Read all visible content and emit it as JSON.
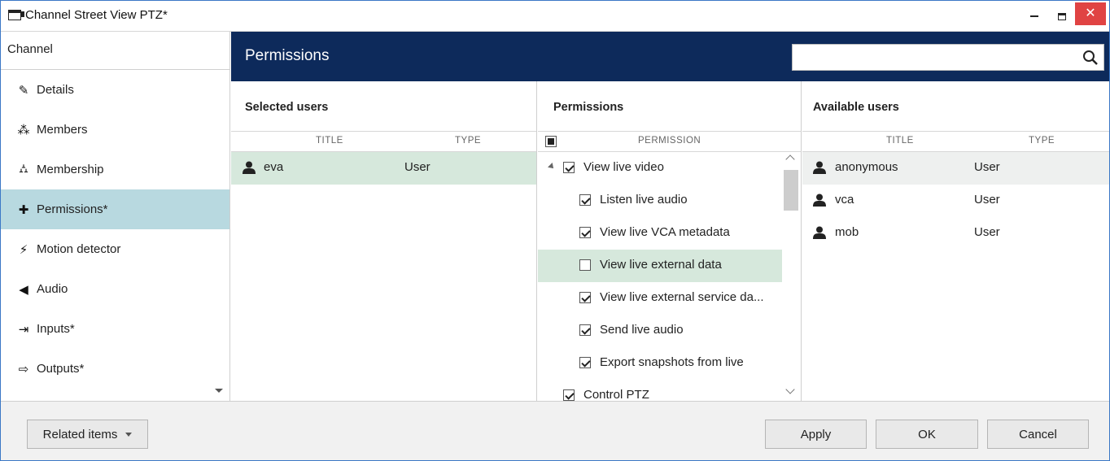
{
  "window": {
    "title": "Channel Street View PTZ*",
    "close_glyph": "✕"
  },
  "nav": {
    "header": "Channel",
    "items": [
      {
        "label": "Details",
        "icon": "pencil-icon",
        "glyph": "✎"
      },
      {
        "label": "Members",
        "icon": "members-icon",
        "glyph": "⁂"
      },
      {
        "label": "Membership",
        "icon": "membership-icon",
        "glyph": "⛼"
      },
      {
        "label": "Permissions*",
        "icon": "puzzle-icon",
        "glyph": "✚",
        "active": true
      },
      {
        "label": "Motion detector",
        "icon": "running-person-icon",
        "glyph": "⚡"
      },
      {
        "label": "Audio",
        "icon": "speaker-icon",
        "glyph": "◀"
      },
      {
        "label": "Inputs*",
        "icon": "input-icon",
        "glyph": "⇥"
      },
      {
        "label": "Outputs*",
        "icon": "output-icon",
        "glyph": "⇨"
      }
    ]
  },
  "content": {
    "title": "Permissions",
    "search": {
      "value": "",
      "placeholder": ""
    }
  },
  "selected_users": {
    "heading": "Selected users",
    "columns": [
      "TITLE",
      "TYPE"
    ],
    "rows": [
      {
        "title": "eva",
        "type": "User",
        "selected": true
      }
    ]
  },
  "permissions": {
    "heading": "Permissions",
    "column": "PERMISSION",
    "items": [
      {
        "label": "View live video",
        "checked": true,
        "level": 0,
        "expander": true
      },
      {
        "label": "Listen live audio",
        "checked": true,
        "level": 1
      },
      {
        "label": "View live VCA metadata",
        "checked": true,
        "level": 1
      },
      {
        "label": "View live external data",
        "checked": false,
        "level": 1,
        "highlighted": true
      },
      {
        "label": "View live external service da...",
        "checked": true,
        "level": 1
      },
      {
        "label": "Send live audio",
        "checked": true,
        "level": 1
      },
      {
        "label": "Export snapshots from live",
        "checked": true,
        "level": 1
      },
      {
        "label": "Control PTZ",
        "checked": true,
        "level": 0
      }
    ]
  },
  "available_users": {
    "heading": "Available users",
    "columns": [
      "TITLE",
      "TYPE"
    ],
    "rows": [
      {
        "title": "anonymous",
        "type": "User",
        "hover": true
      },
      {
        "title": "vca",
        "type": "User"
      },
      {
        "title": "mob",
        "type": "User"
      }
    ]
  },
  "footer": {
    "related": "Related items",
    "apply": "Apply",
    "ok": "OK",
    "cancel": "Cancel"
  }
}
